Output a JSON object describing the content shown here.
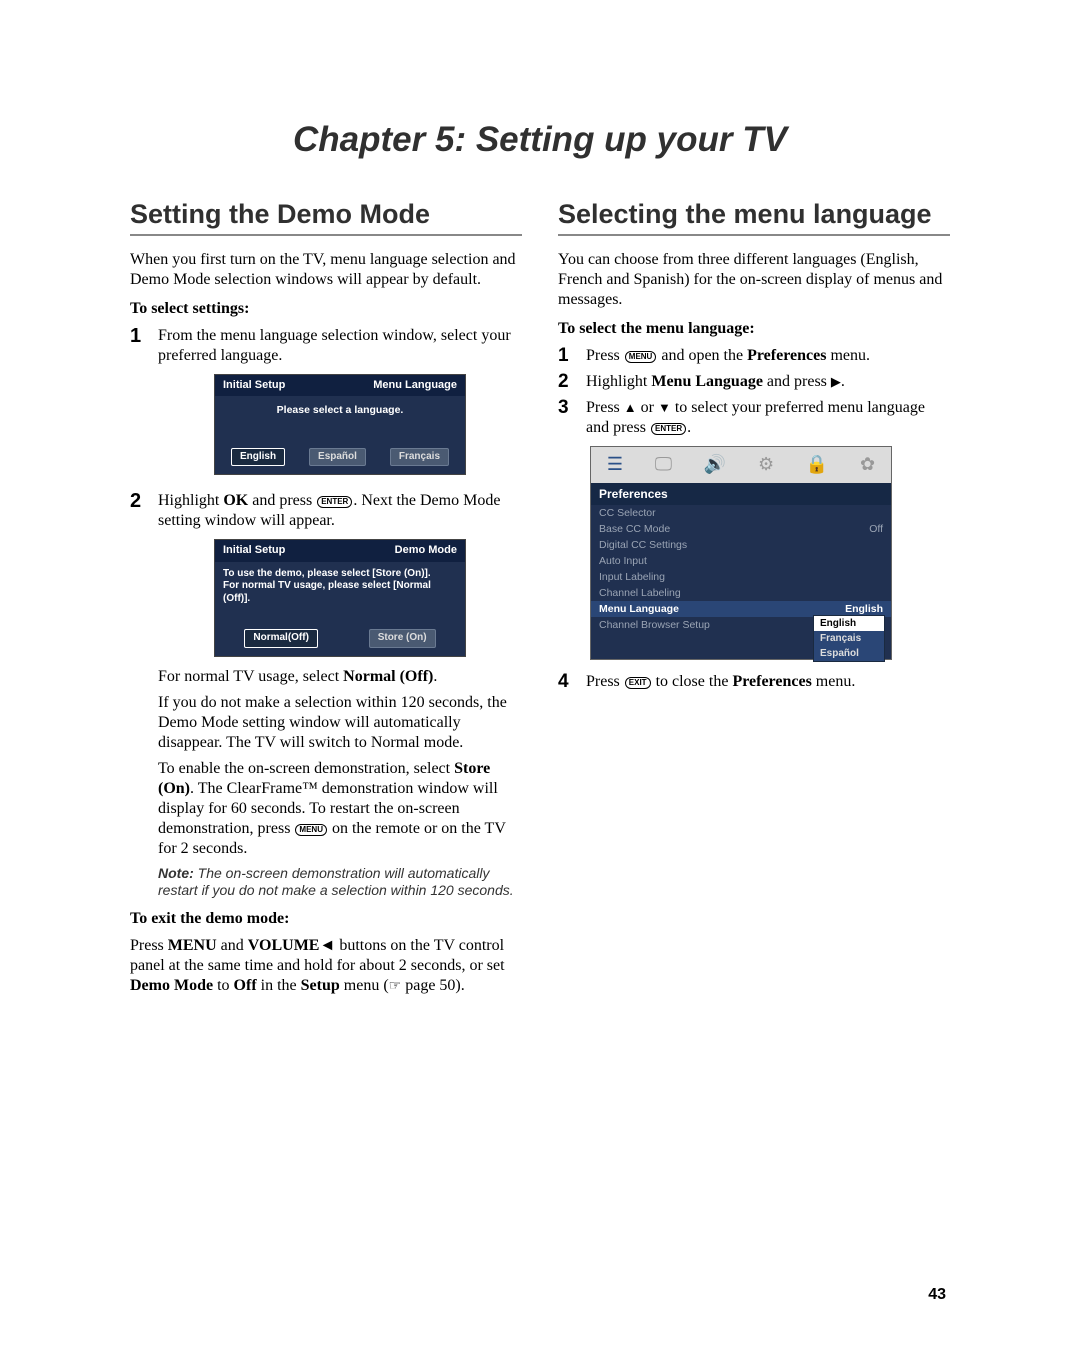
{
  "chapter_title": "Chapter 5: Setting up your TV",
  "page_number": "43",
  "left": {
    "section_title": "Setting the Demo Mode",
    "intro": "When you first turn on the TV, menu language selection and Demo Mode selection windows will appear by default.",
    "select_heading": "To select settings:",
    "step1": "From the menu language selection window, select your preferred language.",
    "lang_box": {
      "left": "Initial Setup",
      "right": "Menu Language",
      "message": "Please select a language.",
      "buttons": [
        "English",
        "Español",
        "Français"
      ],
      "selected": "English"
    },
    "step2a": "Highlight ",
    "step2b": "OK",
    "step2c": " and press ",
    "step2_enter": "ENTER",
    "step2d": ". Next the Demo Mode setting window will appear.",
    "demo_box": {
      "left": "Initial Setup",
      "right": "Demo Mode",
      "message1": "To use the demo, please select [Store (On)].",
      "message2": "For normal TV usage, please select [Normal (Off)].",
      "buttons": [
        "Normal(Off)",
        "Store (On)"
      ],
      "selected": "Normal(Off)"
    },
    "after_demo1a": "For normal TV usage, select ",
    "after_demo1b": "Normal (Off)",
    "after_demo1c": ".",
    "after_demo2": "If you do not make a selection within 120 seconds, the Demo Mode setting window will automatically disappear. The TV will switch to Normal mode.",
    "after_demo3a": "To enable the on-screen demonstration, select ",
    "after_demo3b": "Store (On)",
    "after_demo3c": ". The ClearFrame™ demonstration window will display for 60 seconds. To restart the on-screen demonstration, press ",
    "after_demo3_menu": "MENU",
    "after_demo3d": " on the remote or on the TV for 2 seconds.",
    "note_label": "Note:",
    "note_text": " The on-screen demonstration will automatically restart if you do not make a selection within 120 seconds.",
    "exit_heading": "To exit the demo mode:",
    "exit_text_a": "Press ",
    "exit_menu": "MENU",
    "exit_text_b": " and ",
    "exit_volume": "VOLUME",
    "exit_text_c": " buttons on the TV control panel at the same time and hold for about 2 seconds, or set ",
    "exit_demo_mode": "Demo Mode",
    "exit_text_d": " to ",
    "exit_off": "Off",
    "exit_text_e": " in the ",
    "exit_setup": "Setup",
    "exit_text_f": " menu (",
    "exit_page_ref": " page 50).",
    "pointer": "☞"
  },
  "right": {
    "section_title": "Selecting the menu language",
    "intro": "You can choose from three different languages (English, French and Spanish) for the on-screen display of menus and messages.",
    "select_heading": "To select the menu language:",
    "step1a": "Press ",
    "step1_menu": "MENU",
    "step1b": " and open the ",
    "step1_pref": "Preferences",
    "step1c": " menu.",
    "step2a": "Highlight ",
    "step2_menu_lang": "Menu Language",
    "step2b": " and press ",
    "step2_tri": "▶",
    "step2c": ".",
    "step3a": "Press ",
    "step3_up": "▲",
    "step3b": " or ",
    "step3_down": "▼",
    "step3c": " to select your preferred menu language and press ",
    "step3_enter": "ENTER",
    "step3d": ".",
    "pref_box": {
      "title": "Preferences",
      "rows": [
        {
          "label": "CC Selector",
          "value": ""
        },
        {
          "label": "Base CC Mode",
          "value": "Off"
        },
        {
          "label": "Digital CC Settings",
          "value": ""
        },
        {
          "label": "Auto Input",
          "value": ""
        },
        {
          "label": "Input Labeling",
          "value": ""
        },
        {
          "label": "Channel Labeling",
          "value": ""
        },
        {
          "label": "Menu Language",
          "value": "English",
          "active": true
        },
        {
          "label": "Channel Browser Setup",
          "value": ""
        }
      ],
      "flyout": [
        "English",
        "Français",
        "Español"
      ],
      "flyout_selected": "English"
    },
    "step4a": "Press ",
    "step4_exit": "EXIT",
    "step4b": " to close the ",
    "step4_pref": "Preferences",
    "step4c": " menu."
  }
}
